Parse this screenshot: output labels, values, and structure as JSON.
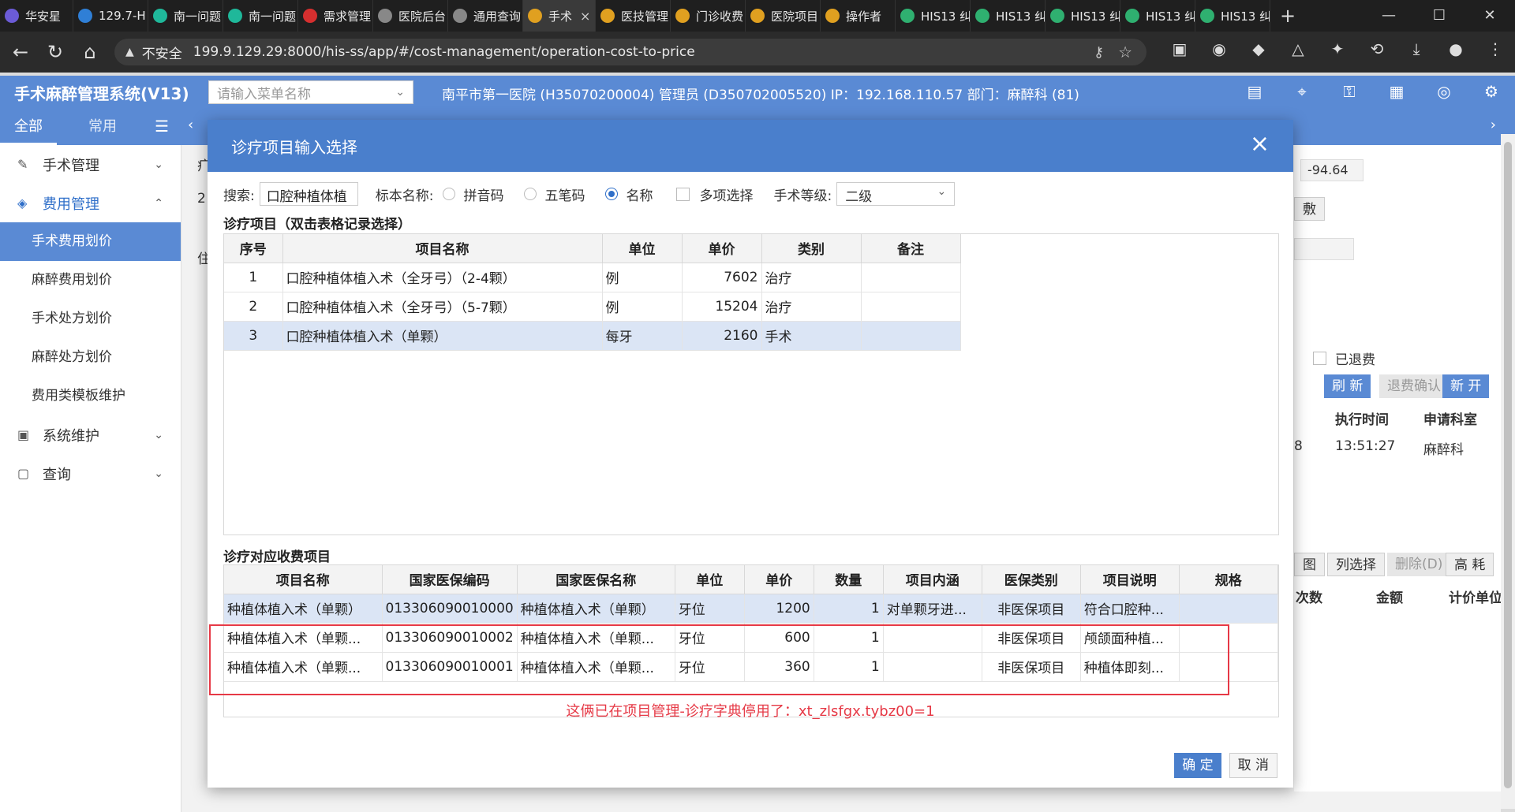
{
  "browser": {
    "tabs": [
      {
        "label": "华安星",
        "color": "#6b5bd6"
      },
      {
        "label": "129.7-H",
        "color": "#2f7fd6"
      },
      {
        "label": "南一问题",
        "color": "#1fb89a"
      },
      {
        "label": "南一问题",
        "color": "#1fb89a"
      },
      {
        "label": "需求管理",
        "color": "#d62f2f"
      },
      {
        "label": "医院后台",
        "color": "#888888"
      },
      {
        "label": "通用查询",
        "color": "#888888"
      },
      {
        "label": "手术",
        "color": "#e0a020",
        "active": true
      },
      {
        "label": "医技管理",
        "color": "#e0a020"
      },
      {
        "label": "门诊收费",
        "color": "#e0a020"
      },
      {
        "label": "医院项目",
        "color": "#e0a020"
      },
      {
        "label": "操作者",
        "color": "#e0a020"
      },
      {
        "label": "HIS13 纠",
        "color": "#2fb070"
      },
      {
        "label": "HIS13 纠",
        "color": "#2fb070"
      },
      {
        "label": "HIS13 纠",
        "color": "#2fb070"
      },
      {
        "label": "HIS13 纠",
        "color": "#2fb070"
      },
      {
        "label": "HIS13 纠",
        "color": "#2fb070"
      }
    ],
    "insecure_label": "不安全",
    "url": "199.9.129.29:8000/his-ss/app/#/cost-management/operation-cost-to-price"
  },
  "app": {
    "title": "手术麻醉管理系统(V13)",
    "menu_search_placeholder": "请输入菜单名称",
    "header_info": "南平市第一医院 (H35070200004) 管理员 (D350702005520) IP：192.168.110.57 部门：麻醉科 (81)"
  },
  "sidebar": {
    "tab_all": "全部",
    "tab_common": "常用",
    "groups": [
      {
        "label": "手术管理",
        "icon": "edit-icon"
      },
      {
        "label": "费用管理",
        "icon": "money-icon"
      },
      {
        "label": "系统维护",
        "icon": "monitor-icon"
      },
      {
        "label": "查询",
        "icon": "search-doc-icon"
      }
    ],
    "items": [
      "手术费用划价",
      "麻醉费用划价",
      "手术处方划价",
      "麻醉处方划价",
      "费用类模板维护"
    ]
  },
  "background": {
    "amount": "-94.64",
    "refunded_label": "已退费",
    "refresh_btn": "刷 新",
    "refund_confirm_btn": "退费确认",
    "new_btn": "新 开",
    "col_exec_time": "执行时间",
    "col_dept": "申请科室",
    "row_partial": "8",
    "row_exec_time": "13:51:27",
    "row_dept": "麻醉科",
    "btn_col_select": "列选择",
    "btn_delete": "删除(D)",
    "btn_high": "高 耗",
    "btn_figure": "图",
    "col_count": "次数",
    "col_amount": "金额",
    "col_unit_price": "计价单位",
    "partial_left_1": "疒",
    "partial_left_2": "2",
    "partial_left_3": "住",
    "partial_right_btn": "敷"
  },
  "modal": {
    "title": "诊疗项目输入选择",
    "search_label": "搜索:",
    "search_value": "口腔种植体植",
    "index_name_label": "标本名称:",
    "radio_pinyin": "拼音码",
    "radio_wubi": "五笔码",
    "radio_name": "名称",
    "multi_select_label": "多项选择",
    "level_label": "手术等级:",
    "level_value": "二级",
    "top_section_title": "诊疗项目（双击表格记录选择）",
    "top_columns": [
      "序号",
      "项目名称",
      "单位",
      "单价",
      "类别",
      "备注"
    ],
    "top_rows": [
      {
        "no": "1",
        "name": "口腔种植体植入术（全牙弓）（2-4颗）",
        "unit": "例",
        "price": "7602",
        "category": "治疗",
        "remark": ""
      },
      {
        "no": "2",
        "name": "口腔种植体植入术（全牙弓）（5-7颗）",
        "unit": "例",
        "price": "15204",
        "category": "治疗",
        "remark": ""
      },
      {
        "no": "3",
        "name": "口腔种植体植入术（单颗）",
        "unit": "每牙",
        "price": "2160",
        "category": "手术",
        "remark": ""
      }
    ],
    "bottom_section_title": "诊疗对应收费项目",
    "bottom_columns": [
      "项目名称",
      "国家医保编码",
      "国家医保名称",
      "单位",
      "单价",
      "数量",
      "项目内涵",
      "医保类别",
      "项目说明",
      "规格"
    ],
    "bottom_rows": [
      {
        "name": "种植体植入术（单颗）",
        "code": "013306090010000",
        "ins_name": "种植体植入术（单颗）",
        "unit": "牙位",
        "price": "1200",
        "qty": "1",
        "content": "对单颗牙进...",
        "ins_type": "非医保项目",
        "desc": "符合口腔种...",
        "spec": ""
      },
      {
        "name": "种植体植入术（单颗...",
        "code": "013306090010002",
        "ins_name": "种植体植入术（单颗...",
        "unit": "牙位",
        "price": "600",
        "qty": "1",
        "content": "",
        "ins_type": "非医保项目",
        "desc": "颅颌面种植...",
        "spec": ""
      },
      {
        "name": "种植体植入术（单颗...",
        "code": "013306090010001",
        "ins_name": "种植体植入术（单颗...",
        "unit": "牙位",
        "price": "360",
        "qty": "1",
        "content": "",
        "ins_type": "非医保项目",
        "desc": "种植体即刻...",
        "spec": ""
      }
    ],
    "annotation": "这俩已在项目管理-诊疗字典停用了：xt_zlsfgx.tybz00=1",
    "ok_label": "确 定",
    "cancel_label": "取 消"
  },
  "colors": {
    "header_blue": "#5a8ad4",
    "modal_blue": "#4a7fcc",
    "annotation_red": "#e63946",
    "selected_row": "#dbe5f5"
  }
}
